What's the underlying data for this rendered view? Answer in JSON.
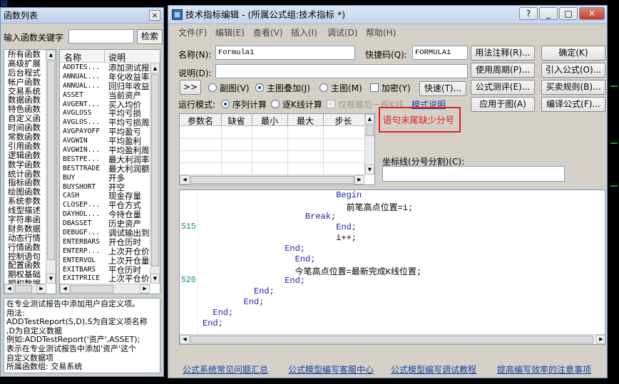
{
  "background": {
    "corner_text": "设"
  },
  "func_window": {
    "title": "函数列表",
    "close_glyph": "×",
    "search_label": "输入函数关键字",
    "search_value": "",
    "search_button": "检索",
    "categories": [
      "所有函数",
      "高级扩展",
      "后台程式",
      "帐户函数",
      "交易系统",
      "数据函数",
      "特色函数",
      "自定义函",
      "时间函数",
      "常数函数",
      "引用函数",
      "逻辑函数",
      "数学函数",
      "统计函数",
      "指标函数",
      "绘图函数",
      "系统参数",
      "线型描述",
      "字符串函",
      "财务数据",
      "动态行情",
      "行情函数",
      "控制语句",
      "配置函数",
      "期权基础",
      "期权数据"
    ],
    "table_headers": {
      "name": "名称",
      "desc": "说明"
    },
    "functions": [
      {
        "name": "ADDTES...",
        "desc": "添加测试报"
      },
      {
        "name": "ANNUAL...",
        "desc": "年化收益率"
      },
      {
        "name": "ANNUAL...",
        "desc": "回归年收益率"
      },
      {
        "name": "ASSET",
        "desc": "当前资产"
      },
      {
        "name": "AVGENT...",
        "desc": "买入均价"
      },
      {
        "name": "AVGLOSS",
        "desc": "平均亏损"
      },
      {
        "name": "AVGLOS...",
        "desc": "平均亏损周期"
      },
      {
        "name": "AVGPAYOFF",
        "desc": "平均盈亏"
      },
      {
        "name": "AVGWIN",
        "desc": "平均盈利"
      },
      {
        "name": "AVGWIN...",
        "desc": "平均盈利周期"
      },
      {
        "name": "BESTPE...",
        "desc": "最大利润率"
      },
      {
        "name": "BESTTRADE",
        "desc": "最大利润额"
      },
      {
        "name": "BUY",
        "desc": "开多"
      },
      {
        "name": "BUYSHORT",
        "desc": "开空"
      },
      {
        "name": "CASH",
        "desc": "现金存量"
      },
      {
        "name": "CLOSEP...",
        "desc": "平仓方式"
      },
      {
        "name": "DAYHOL...",
        "desc": "今持仓量"
      },
      {
        "name": "DBASSET",
        "desc": "历史资产"
      },
      {
        "name": "DEBUGF...",
        "desc": "调试输出到文"
      },
      {
        "name": "ENTERBARS",
        "desc": "开仓历时"
      },
      {
        "name": "ENTERP...",
        "desc": "上次开仓价"
      },
      {
        "name": "ENTERVOL",
        "desc": "上次开仓量"
      },
      {
        "name": "EXITBARS",
        "desc": "平仓历时"
      },
      {
        "name": "EXITPRICE",
        "desc": "上次平仓价"
      }
    ],
    "help_text": "在专业测试报告中添加用户自定义项。\n用法:\nADDTestReport(S,D),S为自定义项名称\n,D为自定义数据\n例如:ADDTestReport('资产',ASSET);\n表示在专业测试报告中添加'资产'这个\n自定义数据项\n所属函数组: 交易系统"
  },
  "editor": {
    "title": "技术指标编辑 - (所属公式组:技术指标 *)",
    "window_buttons": {
      "help": "?",
      "minimize": "_",
      "maximize": "□",
      "close": "✕"
    },
    "menu": [
      "文件(F)",
      "编辑(E)",
      "查看(V)",
      "插入(I)",
      "调试(D)",
      "帮助(H)"
    ],
    "name_label": "名称(N):",
    "name_value": "Formula1",
    "shortcut_label": "快捷码(Q):",
    "shortcut_value": "FORMULA1",
    "desc_label": "说明(D):",
    "desc_value": "",
    "expand_glyph": ">>",
    "options": {
      "subplot": "副图(V)",
      "main_overlay": "主图叠加(J)",
      "main": "主图(M)",
      "encrypt": "加密(Y)"
    },
    "quick_button": "快速(T)...",
    "run_mode_label": "运行模式:",
    "run_modes": {
      "sequence": "序列计算",
      "per_bar": "逐K线计算"
    },
    "last_bar_only": "仅根最后一根K线",
    "mode_help_link": "模式说明",
    "right_buttons": {
      "usage_note": "用法注释(R)...",
      "confirm": "确定(K)",
      "usage_period": "使用周期(P)...",
      "import_formula": "引入公式(O)...",
      "formula_test": "公式测评(E)...",
      "trade_rules": "买卖规则(B)...",
      "apply_to_chart": "应用于图(A)",
      "compile": "编译公式(F)..."
    },
    "param_headers": [
      "参数名",
      "缺省",
      "最小",
      "最大",
      "步长"
    ],
    "error_text": "语句末尾缺少分号",
    "coord_label": "坐标线(分号分割)(C):",
    "coord_value": "",
    "code_lines": [
      {
        "ln": "",
        "text": "Begin",
        "kw": true,
        "indent": 26
      },
      {
        "ln": "",
        "text": "前笔高点位置=i;",
        "kw": false,
        "indent": 28
      },
      {
        "ln": "",
        "text": "Break;",
        "kw": true,
        "indent": 20
      },
      {
        "ln": "515",
        "text": "End;",
        "kw": true,
        "indent": 26
      },
      {
        "ln": "",
        "text": "i++;",
        "kw": false,
        "indent": 26
      },
      {
        "ln": "",
        "text": "End;",
        "kw": true,
        "indent": 16
      },
      {
        "ln": "",
        "text": "End;",
        "kw": true,
        "indent": 18
      },
      {
        "ln": "",
        "text": "今笔高点位置=最新完成K线位置;",
        "kw": false,
        "indent": 18
      },
      {
        "ln": "520",
        "text": "End;",
        "kw": true,
        "indent": 16
      },
      {
        "ln": "",
        "text": "End;",
        "kw": true,
        "indent": 10
      },
      {
        "ln": "",
        "text": "End;",
        "kw": true,
        "indent": 8
      },
      {
        "ln": "",
        "text": "End;",
        "kw": true,
        "indent": 2
      },
      {
        "ln": "",
        "text": "End;",
        "kw": true,
        "indent": 0
      }
    ],
    "bottom_links": [
      "公式系统常见问题汇总",
      "公式模型编写客服中心",
      "公式模型编写调试教程",
      "提高编写效率的注意事项"
    ]
  }
}
